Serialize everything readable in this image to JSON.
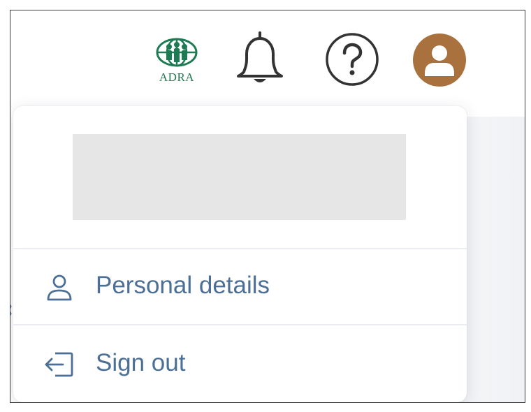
{
  "header": {
    "logo": {
      "text": "ADRA",
      "icon": "globe-people-icon"
    },
    "notifications": {
      "icon": "bell-icon"
    },
    "help": {
      "icon": "question-mark-icon"
    },
    "profile": {
      "icon": "user-avatar-icon"
    }
  },
  "user_menu": {
    "items": [
      {
        "label": "Personal details",
        "icon": "person-icon"
      },
      {
        "label": "Sign out",
        "icon": "sign-out-icon"
      }
    ]
  },
  "colors": {
    "logo_green": "#1d7a52",
    "avatar_brown": "#a8713d",
    "menu_text": "#4c6f96",
    "redacted_block": "#e6e6e6"
  }
}
